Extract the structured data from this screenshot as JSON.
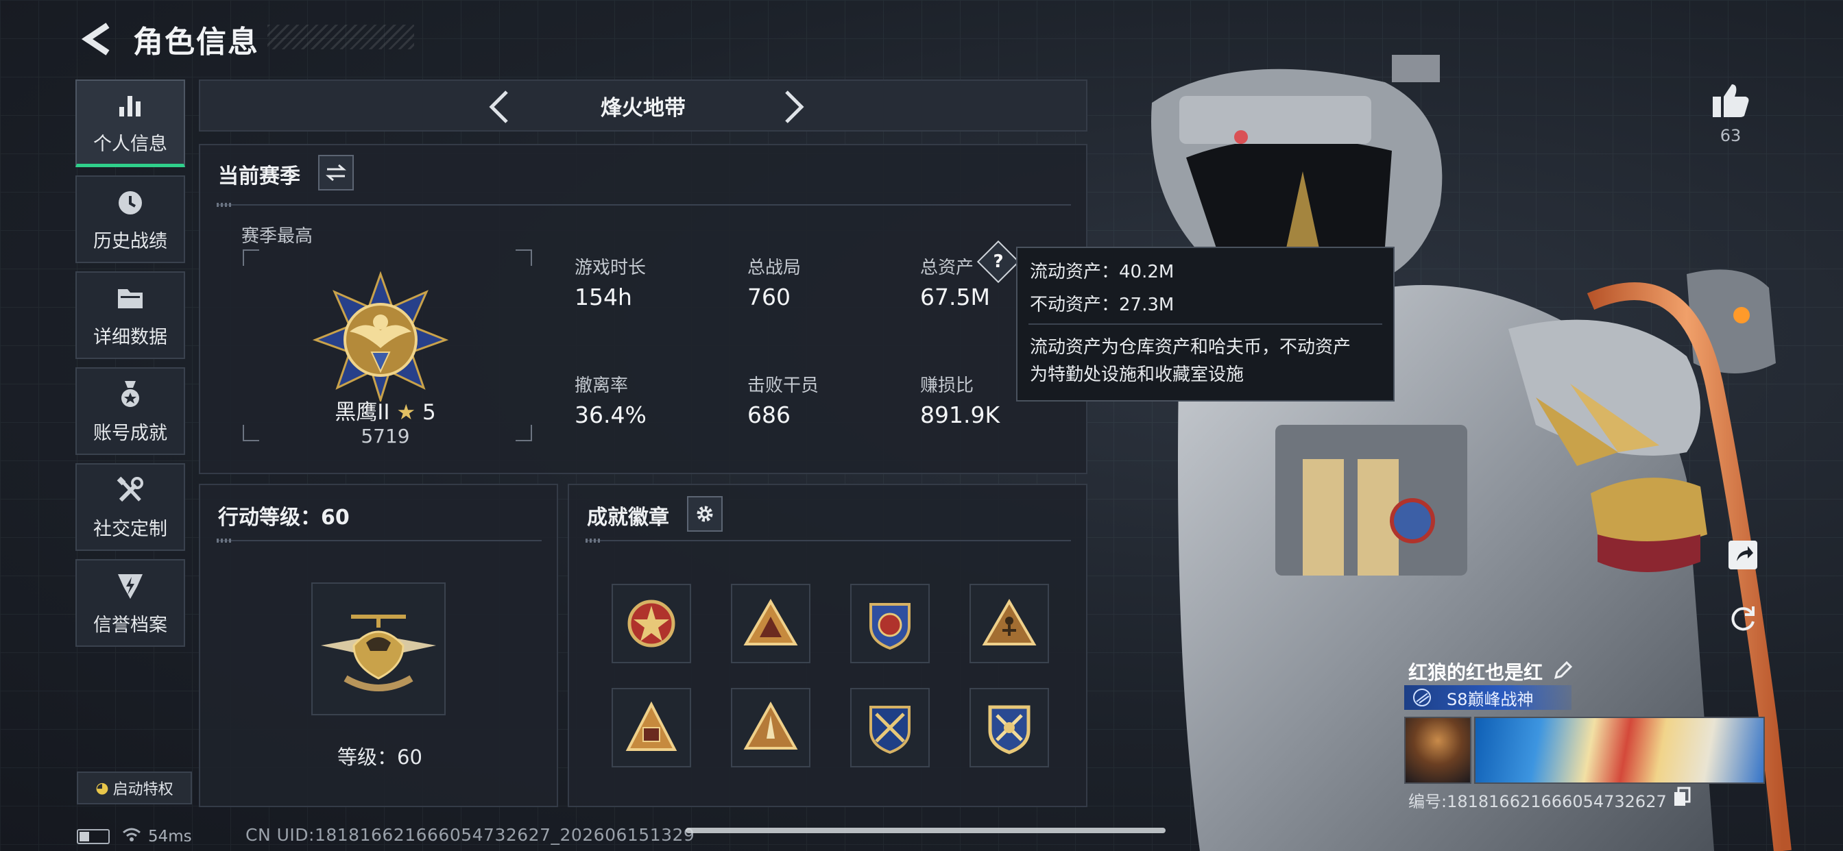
{
  "header": {
    "title": "角色信息"
  },
  "sidebar": {
    "items": [
      {
        "label": "个人信息",
        "icon": "bar-chart-icon",
        "active": true
      },
      {
        "label": "历史战绩",
        "icon": "history-clock-icon"
      },
      {
        "label": "详细数据",
        "icon": "folder-icon"
      },
      {
        "label": "账号成就",
        "icon": "medal-icon"
      },
      {
        "label": "社交定制",
        "icon": "tools-icon"
      },
      {
        "label": "信誉档案",
        "icon": "shield-lightning-icon"
      }
    ],
    "privilege_label": "启动特权"
  },
  "mode": {
    "title": "烽火地带"
  },
  "season": {
    "title": "当前赛季",
    "best_label": "赛季最高",
    "rank_name": "黑鹰II",
    "rank_stars": "5",
    "rank_score": "5719",
    "stats": [
      {
        "label": "游戏时长",
        "value": "154h"
      },
      {
        "label": "总战局",
        "value": "760"
      },
      {
        "label": "总资产",
        "value": "67.5M"
      },
      {
        "label": "撤离率",
        "value": "36.4%"
      },
      {
        "label": "击败干员",
        "value": "686"
      },
      {
        "label": "赚损比",
        "value": "891.9K"
      }
    ]
  },
  "tooltip": {
    "liquid": "流动资产：40.2M",
    "fixed": "不动资产：27.3M",
    "desc1": "流动资产为仓库资产和哈夫币，不动资产",
    "desc2": "为特勤处设施和收藏室设施"
  },
  "action_level": {
    "title": "行动等级：60",
    "level_label": "等级：60"
  },
  "badges": {
    "title": "成就徽章",
    "items": [
      "star-shield-badge",
      "triangle-badge",
      "wing-shield-badge",
      "climber-badge",
      "pyramid-badge",
      "rocket-badge",
      "crossed-shield-badge",
      "crossed-shield-gold-badge"
    ]
  },
  "likes": {
    "count": "63"
  },
  "player": {
    "name": "红狼的红也是红",
    "title": "S8巅峰战神",
    "id_line": "编号:1818166216660547326​27"
  },
  "status": {
    "latency": "54ms",
    "cn_uid": "CN UID:1818166216660547326​27_202606151329"
  },
  "colors": {
    "accent_green": "#2fd08b",
    "gold": "#c9a24a",
    "panel": "#1e232b"
  }
}
